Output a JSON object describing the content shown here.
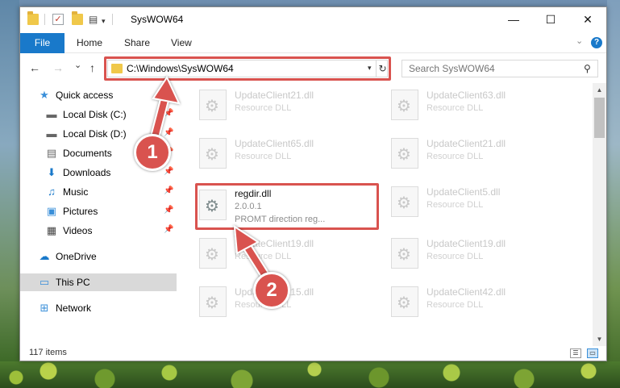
{
  "titlebar": {
    "title": "SysWOW64",
    "minimize_glyph": "—",
    "maximize_glyph": "☐",
    "close_glyph": "✕"
  },
  "ribbon": {
    "tabs": [
      {
        "label": "File",
        "active": true
      },
      {
        "label": "Home"
      },
      {
        "label": "Share"
      },
      {
        "label": "View"
      }
    ],
    "help_glyph": "?"
  },
  "nav": {
    "back_glyph": "←",
    "forward_glyph": "→",
    "recent_glyph": "⌄",
    "up_glyph": "↑",
    "address": "C:\\Windows\\SysWOW64",
    "refresh_glyph": "↻",
    "search_placeholder": "Search SysWOW64",
    "search_icon": "search-icon"
  },
  "navpane": {
    "items": [
      {
        "label": "Quick access",
        "icon": "star-icon",
        "glyph": "★",
        "color": "#3a8fd9"
      },
      {
        "label": "Local Disk (C:)",
        "icon": "drive-icon",
        "glyph": "▬",
        "pinned": true
      },
      {
        "label": "Local Disk (D:)",
        "icon": "drive-icon",
        "glyph": "▬",
        "pinned": true
      },
      {
        "label": "Documents",
        "icon": "documents-icon",
        "glyph": "▤",
        "pinned": true
      },
      {
        "label": "Downloads",
        "icon": "download-icon",
        "glyph": "⬇",
        "color": "#1979ca",
        "pinned": true
      },
      {
        "label": "Music",
        "icon": "music-icon",
        "glyph": "♫",
        "color": "#1979ca",
        "pinned": true
      },
      {
        "label": "Pictures",
        "icon": "pictures-icon",
        "glyph": "▣",
        "color": "#3a8fd9",
        "pinned": true
      },
      {
        "label": "Videos",
        "icon": "videos-icon",
        "glyph": "▦",
        "pinned": true
      },
      {
        "label": "OneDrive",
        "icon": "cloud-icon",
        "glyph": "☁",
        "color": "#1979ca"
      },
      {
        "label": "This PC",
        "icon": "computer-icon",
        "glyph": "▭",
        "color": "#3a8fd9",
        "selected": true
      },
      {
        "label": "Network",
        "icon": "network-icon",
        "glyph": "⊞",
        "color": "#3a8fd9"
      }
    ]
  },
  "files": [
    {
      "name": "UpdateClient21.dll",
      "sub": "Resource DLL"
    },
    {
      "name": "UpdateClient63.dll",
      "sub": "Resource DLL"
    },
    {
      "name": "UpdateClient65.dll",
      "sub": "Resource DLL"
    },
    {
      "name": "UpdateClient21.dll",
      "sub": "Resource DLL"
    },
    {
      "name": "regdir.dll",
      "sub": "2.0.0.1",
      "sub2": "PROMT direction reg...",
      "highlight": true
    },
    {
      "name": "UpdateClient5.dll",
      "sub": "Resource DLL"
    },
    {
      "name": "UpdateClient19.dll",
      "sub": "Resource DLL"
    },
    {
      "name": "UpdateClient19.dll",
      "sub": "Resource DLL"
    },
    {
      "name": "UpdateClient15.dll",
      "sub": "Resource DLL"
    },
    {
      "name": "UpdateClient42.dll",
      "sub": "Resource DLL"
    }
  ],
  "status": {
    "count": "117 items"
  },
  "annotations": {
    "step1": "1",
    "step2": "2",
    "accent": "#d9534f"
  }
}
